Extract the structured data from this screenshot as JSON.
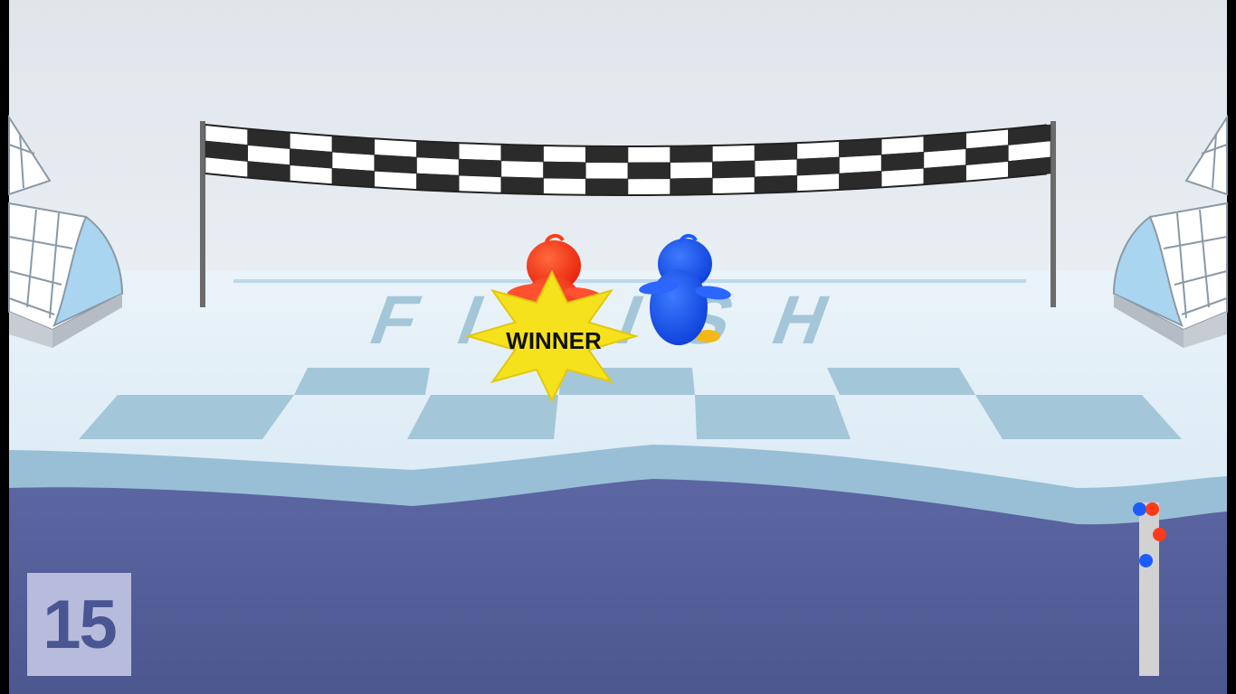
{
  "hud": {
    "score": "15",
    "winner_label": "WINNER",
    "finish_text": "FINISH"
  },
  "colors": {
    "red_player": "#ff3a1a",
    "blue_player": "#1a5cff",
    "winner_star": "#f5e21c",
    "water": "#55609e",
    "ice": "#e8f2f8"
  },
  "race_progress": {
    "blue_player": 0.0,
    "red_player": 0.0,
    "red_opponent": 0.16,
    "blue_opponent": 0.32
  }
}
